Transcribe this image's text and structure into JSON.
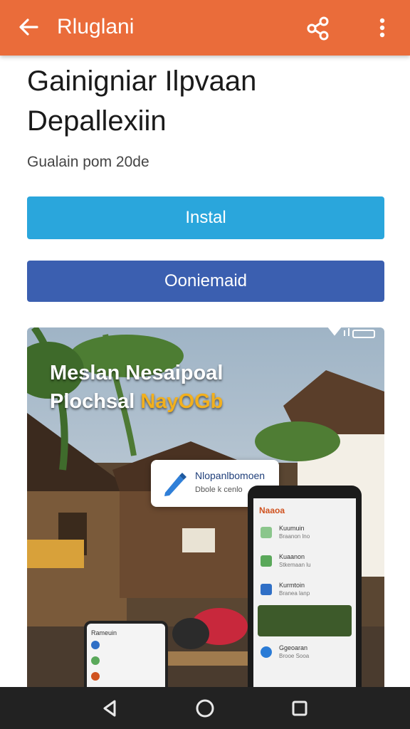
{
  "app_bar": {
    "back_icon": "arrow-left-icon",
    "title": "Rluglani",
    "share_icon": "share-icon",
    "more_icon": "more-vert-icon"
  },
  "app": {
    "title_line1": "Gainigniar Ilpvaan",
    "title_line2": "Depallexiin",
    "subtitle": "Gualain pom 20de"
  },
  "buttons": {
    "install": "Instal",
    "download": "Ooniemaid"
  },
  "banner": {
    "headline_line1": "Meslan Nesaipoal",
    "headline_line2_a": "Plochsal ",
    "headline_line2_b": "NayOGb",
    "callout_title": "Nlopanlbomoen",
    "callout_sub": "Dbole k cenlo",
    "phone_title": "Naaoa",
    "phone_items": [
      {
        "label": "Kuumuin",
        "sub": "Braanon lno"
      },
      {
        "label": "Kuaanon",
        "sub": "Stkemaan lu"
      },
      {
        "label": "Kurmtoin",
        "sub": "Branea lanp"
      },
      {
        "label": "Ggeoaran",
        "sub": "Brooe Sooa"
      }
    ],
    "phone2_title": "Rameuin"
  },
  "colors": {
    "app_bar": "#ea6c3a",
    "install_button": "#2aa6dc",
    "download_button": "#3b5fb0",
    "nav_bar": "#222222",
    "headline_accent": "#f2b01e"
  },
  "nav": {
    "back_icon": "nav-back-icon",
    "home_icon": "nav-home-icon",
    "recents_icon": "nav-recents-icon"
  }
}
